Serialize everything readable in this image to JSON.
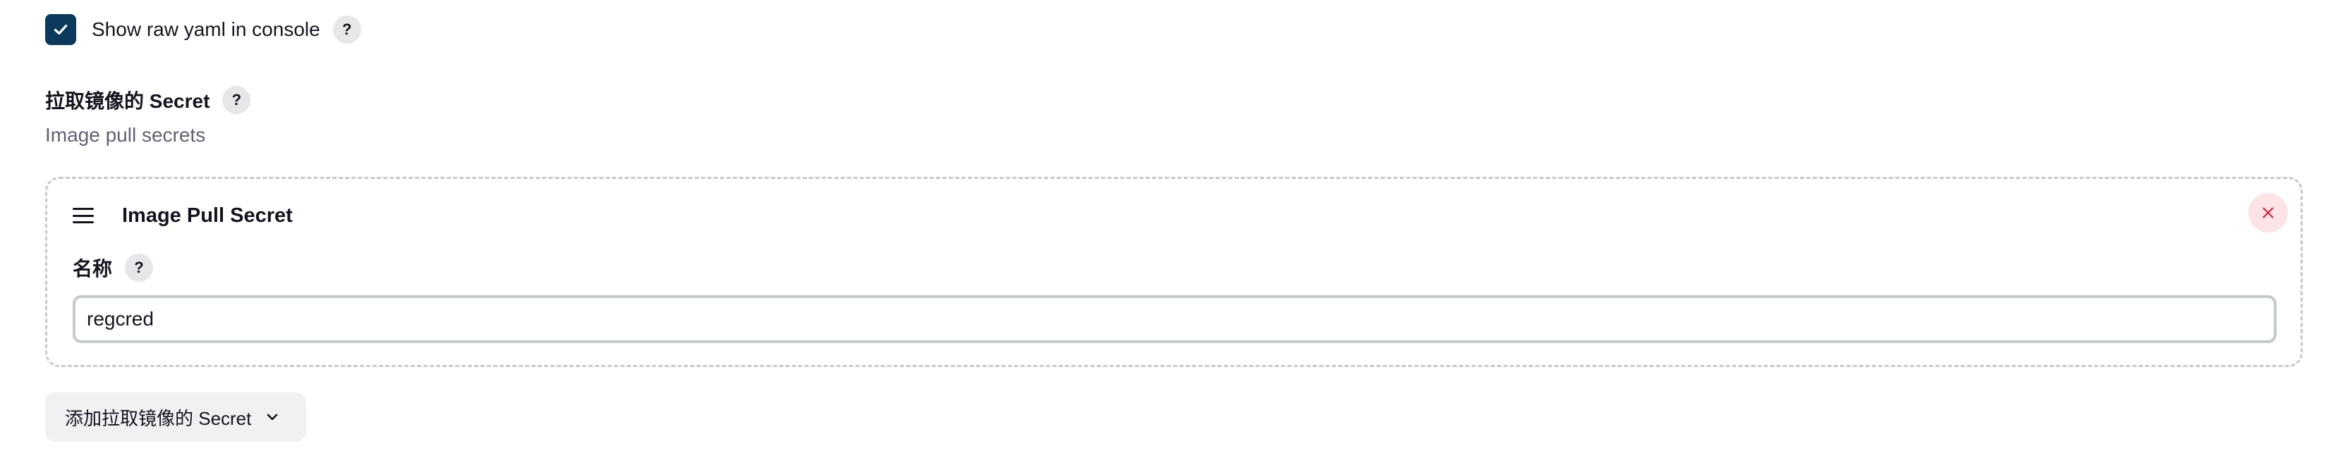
{
  "raw_yaml": {
    "label": "Show raw yaml in console",
    "checked": true,
    "help_symbol": "?"
  },
  "image_pull_secrets": {
    "title": "拉取镜像的 Secret",
    "help_symbol": "?",
    "description": "Image pull secrets",
    "items": [
      {
        "title": "Image Pull Secret",
        "field_label": "名称",
        "help_symbol": "?",
        "value": "regcred"
      }
    ],
    "add_button_label": "添加拉取镜像的 Secret"
  },
  "icons": {
    "checkbox": "check-icon",
    "drag": "drag-handle-icon",
    "delete": "close-icon",
    "add_chevron": "chevron-down-icon"
  },
  "colors": {
    "checkbox_bg": "#0b3a5c",
    "delete_bg": "#fbe3e6",
    "delete_x": "#d0334b",
    "description_text": "#606272"
  }
}
